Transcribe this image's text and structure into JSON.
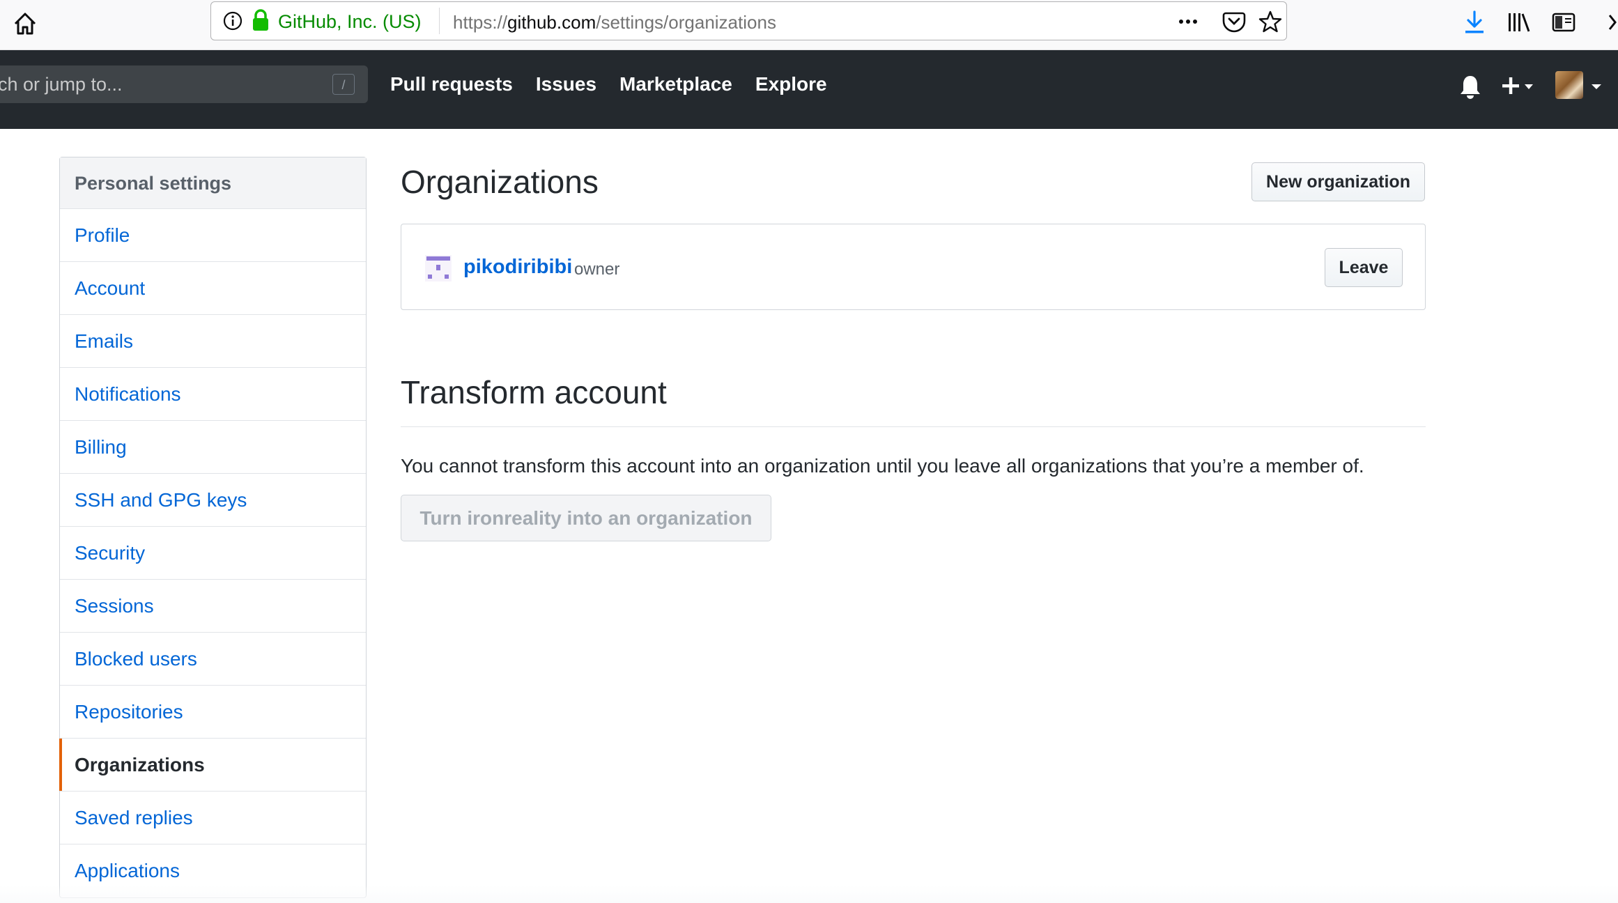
{
  "browser": {
    "identity": "GitHub, Inc. (US)",
    "url_prefix": "https://",
    "url_host": "github.com",
    "url_path": "/settings/organizations"
  },
  "header": {
    "search_placeholder": "rch or jump to...",
    "slash_key": "/",
    "nav": [
      "Pull requests",
      "Issues",
      "Marketplace",
      "Explore"
    ]
  },
  "sidebar": {
    "title": "Personal settings",
    "items": [
      {
        "label": "Profile"
      },
      {
        "label": "Account"
      },
      {
        "label": "Emails"
      },
      {
        "label": "Notifications"
      },
      {
        "label": "Billing"
      },
      {
        "label": "SSH and GPG keys"
      },
      {
        "label": "Security"
      },
      {
        "label": "Sessions"
      },
      {
        "label": "Blocked users"
      },
      {
        "label": "Repositories"
      },
      {
        "label": "Organizations",
        "selected": true
      },
      {
        "label": "Saved replies"
      },
      {
        "label": "Applications"
      }
    ]
  },
  "main": {
    "title": "Organizations",
    "new_org_button": "New organization",
    "org": {
      "name": "pikodiribibi",
      "role": "owner",
      "leave_button": "Leave"
    },
    "transform": {
      "title": "Transform account",
      "text": "You cannot transform this account into an organization until you leave all organizations that you’re a member of.",
      "button": "Turn ironreality into an organization"
    }
  },
  "colors": {
    "header_bg": "#24292e",
    "link": "#0366d6",
    "selected_marker": "#e36209",
    "identity_green": "#058b00",
    "download_blue": "#0a84ff"
  }
}
